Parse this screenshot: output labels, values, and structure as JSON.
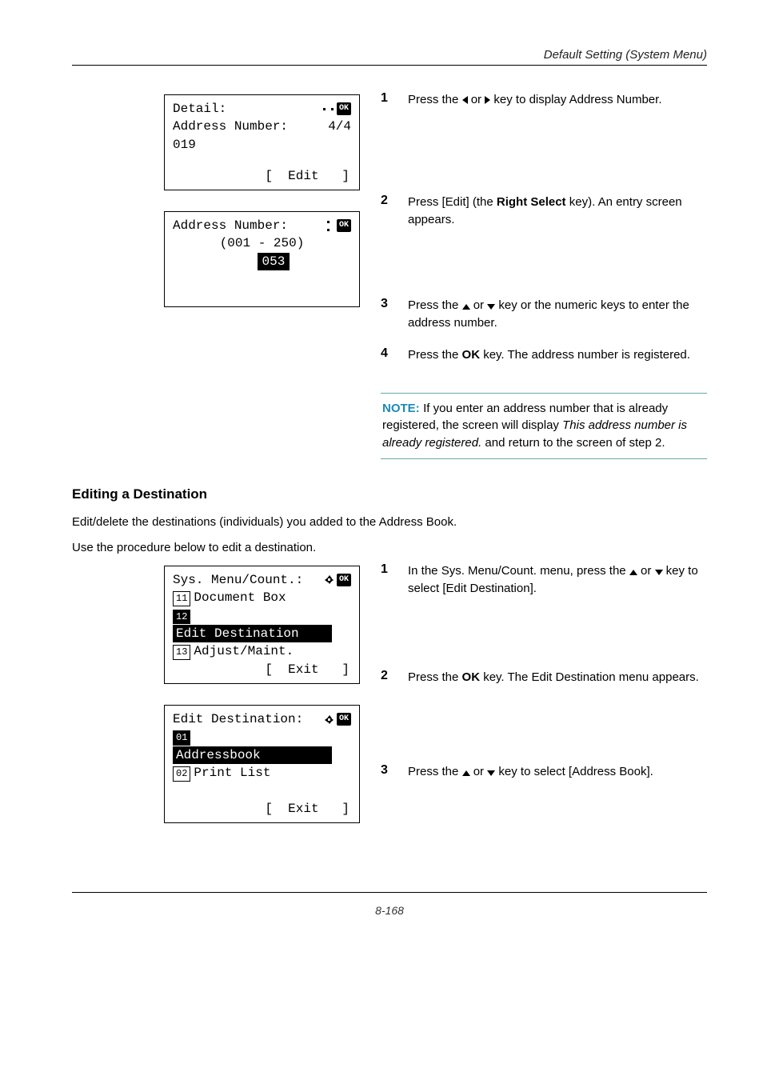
{
  "header": {
    "running_title": "Default Setting (System Menu)"
  },
  "lcd1": {
    "title": "Detail:",
    "line1_label": "Address Number:",
    "line1_val": "4/4",
    "line2": "019",
    "softkey": "[  Edit   ]"
  },
  "lcd2": {
    "title": "Address Number:",
    "range": "(001 - 250)",
    "value_prefix": "   ",
    "value": "053"
  },
  "steps_a": {
    "s1": "Press the ◁ or ▷ key to display Address Number.",
    "s2_a": "Press [Edit] (the ",
    "s2_bold": "Right Select",
    "s2_b": " key). An entry screen appears.",
    "s3": "Press the △ or ▽ key or the numeric keys to enter the address number.",
    "s4_a": "Press the ",
    "s4_bold": "OK",
    "s4_b": " key. The address number is registered."
  },
  "note": {
    "label": "NOTE:",
    "text_a": " If you enter an address number that is already registered, the screen will display ",
    "text_i": "This address number is already registered.",
    "text_b": " and return to the screen of step 2."
  },
  "section": {
    "heading": "Editing a Destination",
    "p1": "Edit/delete the destinations (individuals) you added to the Address Book.",
    "p2": "Use the procedure below to edit a destination."
  },
  "lcd3": {
    "title": "Sys. Menu/Count.:",
    "item1_num": "11",
    "item1": "Document Box",
    "item2_num": "12",
    "item2": "Edit Destination",
    "item3_num": "13",
    "item3": "Adjust/Maint.",
    "softkey": "[  Exit   ]"
  },
  "lcd4": {
    "title": "Edit Destination:",
    "item1_num": "01",
    "item1": "Addressbook",
    "item2_num": "02",
    "item2": "Print List",
    "softkey": "[  Exit   ]"
  },
  "steps_b": {
    "s1": "In the Sys. Menu/Count. menu, press the △ or ▽ key to select [Edit Destination].",
    "s2_a": "Press the ",
    "s2_bold": "OK",
    "s2_b": " key. The Edit Destination menu appears.",
    "s3": "Press the △ or ▽ key to select [Address Book]."
  },
  "pagenum": "8-168"
}
